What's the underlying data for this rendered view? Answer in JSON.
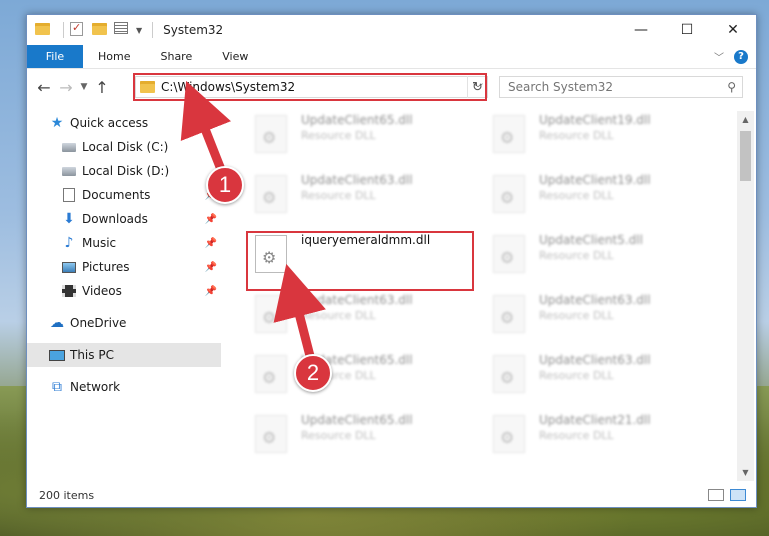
{
  "window": {
    "title": "System32",
    "controls": {
      "minimize": "—",
      "maximize": "☐",
      "close": "✕"
    }
  },
  "ribbon": {
    "tabs": [
      "File",
      "Home",
      "Share",
      "View"
    ]
  },
  "address": {
    "path": "C:\\Windows\\System32"
  },
  "search": {
    "placeholder": "Search System32"
  },
  "sidebar": {
    "items": [
      {
        "label": "Quick access",
        "icon": "star-icon",
        "pinned": false
      },
      {
        "label": "Local Disk (C:)",
        "icon": "drive-icon",
        "pinned": false
      },
      {
        "label": "Local Disk (D:)",
        "icon": "drive-icon",
        "pinned": false
      },
      {
        "label": "Documents",
        "icon": "documents-icon",
        "pinned": true
      },
      {
        "label": "Downloads",
        "icon": "download-icon",
        "pinned": true
      },
      {
        "label": "Music",
        "icon": "music-icon",
        "pinned": true
      },
      {
        "label": "Pictures",
        "icon": "pictures-icon",
        "pinned": true
      },
      {
        "label": "Videos",
        "icon": "videos-icon",
        "pinned": true
      },
      {
        "label": "OneDrive",
        "icon": "onedrive-icon",
        "pinned": false
      },
      {
        "label": "This PC",
        "icon": "pc-icon",
        "pinned": false,
        "selected": true
      },
      {
        "label": "Network",
        "icon": "network-icon",
        "pinned": false
      }
    ]
  },
  "files": [
    {
      "name": "UpdateClient65.dll",
      "type": "Resource DLL",
      "blurred": true
    },
    {
      "name": "UpdateClient19.dll",
      "type": "Resource DLL",
      "blurred": true
    },
    {
      "name": "UpdateClient63.dll",
      "type": "Resource DLL",
      "blurred": true
    },
    {
      "name": "UpdateClient19.dll",
      "type": "Resource DLL",
      "blurred": true
    },
    {
      "name": "iqueryemeraldmm.dll",
      "type": "",
      "blurred": false,
      "highlighted": true
    },
    {
      "name": "UpdateClient5.dll",
      "type": "Resource DLL",
      "blurred": true
    },
    {
      "name": "UpdateClient63.dll",
      "type": "Resource DLL",
      "blurred": true
    },
    {
      "name": "UpdateClient63.dll",
      "type": "Resource DLL",
      "blurred": true
    },
    {
      "name": "UpdateClient65.dll",
      "type": "Resource DLL",
      "blurred": true
    },
    {
      "name": "UpdateClient63.dll",
      "type": "Resource DLL",
      "blurred": true
    },
    {
      "name": "UpdateClient65.dll",
      "type": "Resource DLL",
      "blurred": true
    },
    {
      "name": "UpdateClient21.dll",
      "type": "Resource DLL",
      "blurred": true
    }
  ],
  "status": {
    "item_count": "200 items"
  },
  "callouts": [
    "1",
    "2"
  ],
  "colors": {
    "accent": "#1979ca",
    "highlight_red": "#d9363e"
  }
}
